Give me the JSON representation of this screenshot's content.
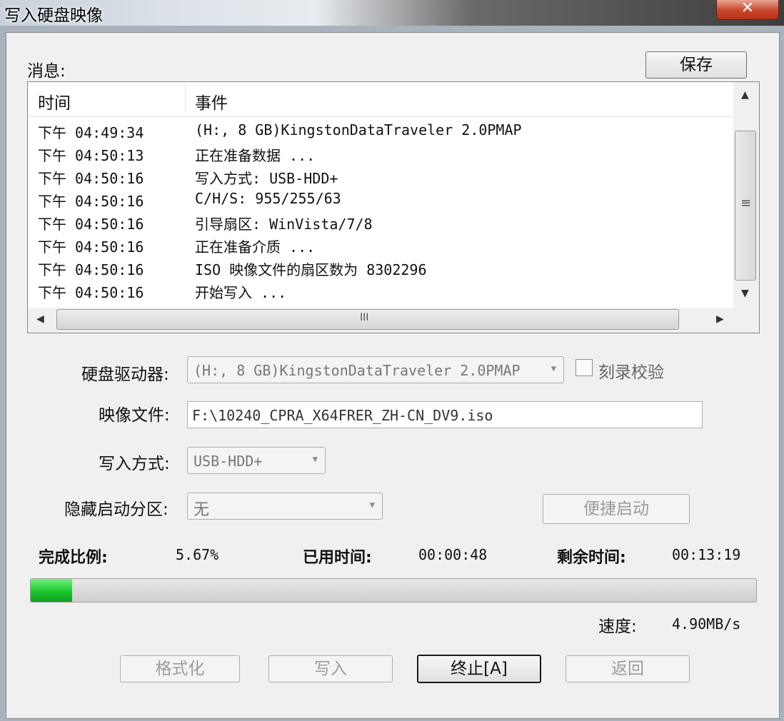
{
  "window": {
    "title": "写入硬盘映像",
    "close_glyph": "✕"
  },
  "messages": {
    "label": "消息:",
    "save_label": "保存",
    "columns": {
      "time": "时间",
      "event": "事件"
    },
    "rows": [
      {
        "time": "下午 04:49:34",
        "event": "(H:, 8 GB)KingstonDataTraveler 2.0PMAP"
      },
      {
        "time": "下午 04:50:13",
        "event": "正在准备数据 ..."
      },
      {
        "time": "下午 04:50:16",
        "event": "写入方式: USB-HDD+"
      },
      {
        "time": "下午 04:50:16",
        "event": "C/H/S: 955/255/63"
      },
      {
        "time": "下午 04:50:16",
        "event": "引导扇区: WinVista/7/8"
      },
      {
        "time": "下午 04:50:16",
        "event": "正在准备介质 ..."
      },
      {
        "time": "下午 04:50:16",
        "event": "ISO 映像文件的扇区数为 8302296"
      },
      {
        "time": "下午 04:50:16",
        "event": "开始写入 ..."
      }
    ],
    "vgrip": "≡",
    "hgrip": "III"
  },
  "form": {
    "drive_label": "硬盘驱动器:",
    "drive_value": "(H:, 8 GB)KingstonDataTraveler 2.0PMAP",
    "verify_label": "刻录校验",
    "image_label": "映像文件:",
    "image_value": "F:\\10240_CPRA_X64FRER_ZH-CN_DV9.iso",
    "method_label": "写入方式:",
    "method_value": "USB-HDD+",
    "hide_label": "隐藏启动分区:",
    "hide_value": "无",
    "quickboot_label": "便捷启动"
  },
  "progress": {
    "percent_label": "完成比例:",
    "percent_value": "5.67%",
    "percent_fraction": 0.0567,
    "elapsed_label": "已用时间:",
    "elapsed_value": "00:00:48",
    "remaining_label": "剩余时间:",
    "remaining_value": "00:13:19",
    "speed_label": "速度:",
    "speed_value": "4.90MB/s"
  },
  "buttons": {
    "format": "格式化",
    "write": "写入",
    "abort": "终止[A]",
    "back": "返回"
  },
  "colors": {
    "progress_fill": "#19c42a",
    "close": "#c9452a"
  }
}
